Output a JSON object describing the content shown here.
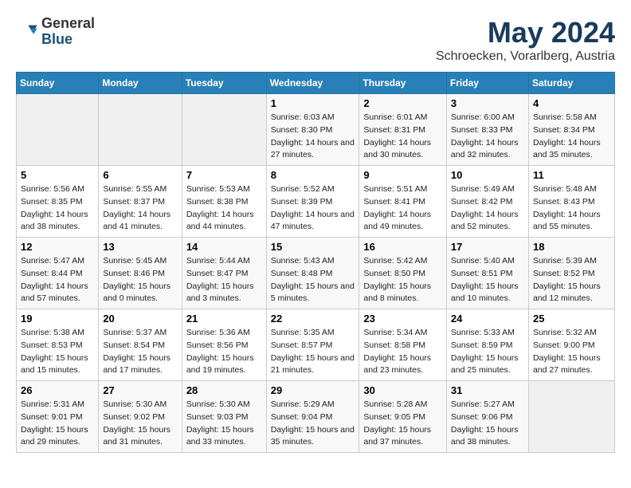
{
  "logo": {
    "general": "General",
    "blue": "Blue"
  },
  "title": "May 2024",
  "subtitle": "Schroecken, Vorarlberg, Austria",
  "days_of_week": [
    "Sunday",
    "Monday",
    "Tuesday",
    "Wednesday",
    "Thursday",
    "Friday",
    "Saturday"
  ],
  "weeks": [
    [
      null,
      null,
      null,
      {
        "day": "1",
        "sunrise": "Sunrise: 6:03 AM",
        "sunset": "Sunset: 8:30 PM",
        "daylight": "Daylight: 14 hours and 27 minutes."
      },
      {
        "day": "2",
        "sunrise": "Sunrise: 6:01 AM",
        "sunset": "Sunset: 8:31 PM",
        "daylight": "Daylight: 14 hours and 30 minutes."
      },
      {
        "day": "3",
        "sunrise": "Sunrise: 6:00 AM",
        "sunset": "Sunset: 8:33 PM",
        "daylight": "Daylight: 14 hours and 32 minutes."
      },
      {
        "day": "4",
        "sunrise": "Sunrise: 5:58 AM",
        "sunset": "Sunset: 8:34 PM",
        "daylight": "Daylight: 14 hours and 35 minutes."
      }
    ],
    [
      {
        "day": "5",
        "sunrise": "Sunrise: 5:56 AM",
        "sunset": "Sunset: 8:35 PM",
        "daylight": "Daylight: 14 hours and 38 minutes."
      },
      {
        "day": "6",
        "sunrise": "Sunrise: 5:55 AM",
        "sunset": "Sunset: 8:37 PM",
        "daylight": "Daylight: 14 hours and 41 minutes."
      },
      {
        "day": "7",
        "sunrise": "Sunrise: 5:53 AM",
        "sunset": "Sunset: 8:38 PM",
        "daylight": "Daylight: 14 hours and 44 minutes."
      },
      {
        "day": "8",
        "sunrise": "Sunrise: 5:52 AM",
        "sunset": "Sunset: 8:39 PM",
        "daylight": "Daylight: 14 hours and 47 minutes."
      },
      {
        "day": "9",
        "sunrise": "Sunrise: 5:51 AM",
        "sunset": "Sunset: 8:41 PM",
        "daylight": "Daylight: 14 hours and 49 minutes."
      },
      {
        "day": "10",
        "sunrise": "Sunrise: 5:49 AM",
        "sunset": "Sunset: 8:42 PM",
        "daylight": "Daylight: 14 hours and 52 minutes."
      },
      {
        "day": "11",
        "sunrise": "Sunrise: 5:48 AM",
        "sunset": "Sunset: 8:43 PM",
        "daylight": "Daylight: 14 hours and 55 minutes."
      }
    ],
    [
      {
        "day": "12",
        "sunrise": "Sunrise: 5:47 AM",
        "sunset": "Sunset: 8:44 PM",
        "daylight": "Daylight: 14 hours and 57 minutes."
      },
      {
        "day": "13",
        "sunrise": "Sunrise: 5:45 AM",
        "sunset": "Sunset: 8:46 PM",
        "daylight": "Daylight: 15 hours and 0 minutes."
      },
      {
        "day": "14",
        "sunrise": "Sunrise: 5:44 AM",
        "sunset": "Sunset: 8:47 PM",
        "daylight": "Daylight: 15 hours and 3 minutes."
      },
      {
        "day": "15",
        "sunrise": "Sunrise: 5:43 AM",
        "sunset": "Sunset: 8:48 PM",
        "daylight": "Daylight: 15 hours and 5 minutes."
      },
      {
        "day": "16",
        "sunrise": "Sunrise: 5:42 AM",
        "sunset": "Sunset: 8:50 PM",
        "daylight": "Daylight: 15 hours and 8 minutes."
      },
      {
        "day": "17",
        "sunrise": "Sunrise: 5:40 AM",
        "sunset": "Sunset: 8:51 PM",
        "daylight": "Daylight: 15 hours and 10 minutes."
      },
      {
        "day": "18",
        "sunrise": "Sunrise: 5:39 AM",
        "sunset": "Sunset: 8:52 PM",
        "daylight": "Daylight: 15 hours and 12 minutes."
      }
    ],
    [
      {
        "day": "19",
        "sunrise": "Sunrise: 5:38 AM",
        "sunset": "Sunset: 8:53 PM",
        "daylight": "Daylight: 15 hours and 15 minutes."
      },
      {
        "day": "20",
        "sunrise": "Sunrise: 5:37 AM",
        "sunset": "Sunset: 8:54 PM",
        "daylight": "Daylight: 15 hours and 17 minutes."
      },
      {
        "day": "21",
        "sunrise": "Sunrise: 5:36 AM",
        "sunset": "Sunset: 8:56 PM",
        "daylight": "Daylight: 15 hours and 19 minutes."
      },
      {
        "day": "22",
        "sunrise": "Sunrise: 5:35 AM",
        "sunset": "Sunset: 8:57 PM",
        "daylight": "Daylight: 15 hours and 21 minutes."
      },
      {
        "day": "23",
        "sunrise": "Sunrise: 5:34 AM",
        "sunset": "Sunset: 8:58 PM",
        "daylight": "Daylight: 15 hours and 23 minutes."
      },
      {
        "day": "24",
        "sunrise": "Sunrise: 5:33 AM",
        "sunset": "Sunset: 8:59 PM",
        "daylight": "Daylight: 15 hours and 25 minutes."
      },
      {
        "day": "25",
        "sunrise": "Sunrise: 5:32 AM",
        "sunset": "Sunset: 9:00 PM",
        "daylight": "Daylight: 15 hours and 27 minutes."
      }
    ],
    [
      {
        "day": "26",
        "sunrise": "Sunrise: 5:31 AM",
        "sunset": "Sunset: 9:01 PM",
        "daylight": "Daylight: 15 hours and 29 minutes."
      },
      {
        "day": "27",
        "sunrise": "Sunrise: 5:30 AM",
        "sunset": "Sunset: 9:02 PM",
        "daylight": "Daylight: 15 hours and 31 minutes."
      },
      {
        "day": "28",
        "sunrise": "Sunrise: 5:30 AM",
        "sunset": "Sunset: 9:03 PM",
        "daylight": "Daylight: 15 hours and 33 minutes."
      },
      {
        "day": "29",
        "sunrise": "Sunrise: 5:29 AM",
        "sunset": "Sunset: 9:04 PM",
        "daylight": "Daylight: 15 hours and 35 minutes."
      },
      {
        "day": "30",
        "sunrise": "Sunrise: 5:28 AM",
        "sunset": "Sunset: 9:05 PM",
        "daylight": "Daylight: 15 hours and 37 minutes."
      },
      {
        "day": "31",
        "sunrise": "Sunrise: 5:27 AM",
        "sunset": "Sunset: 9:06 PM",
        "daylight": "Daylight: 15 hours and 38 minutes."
      },
      null
    ]
  ]
}
